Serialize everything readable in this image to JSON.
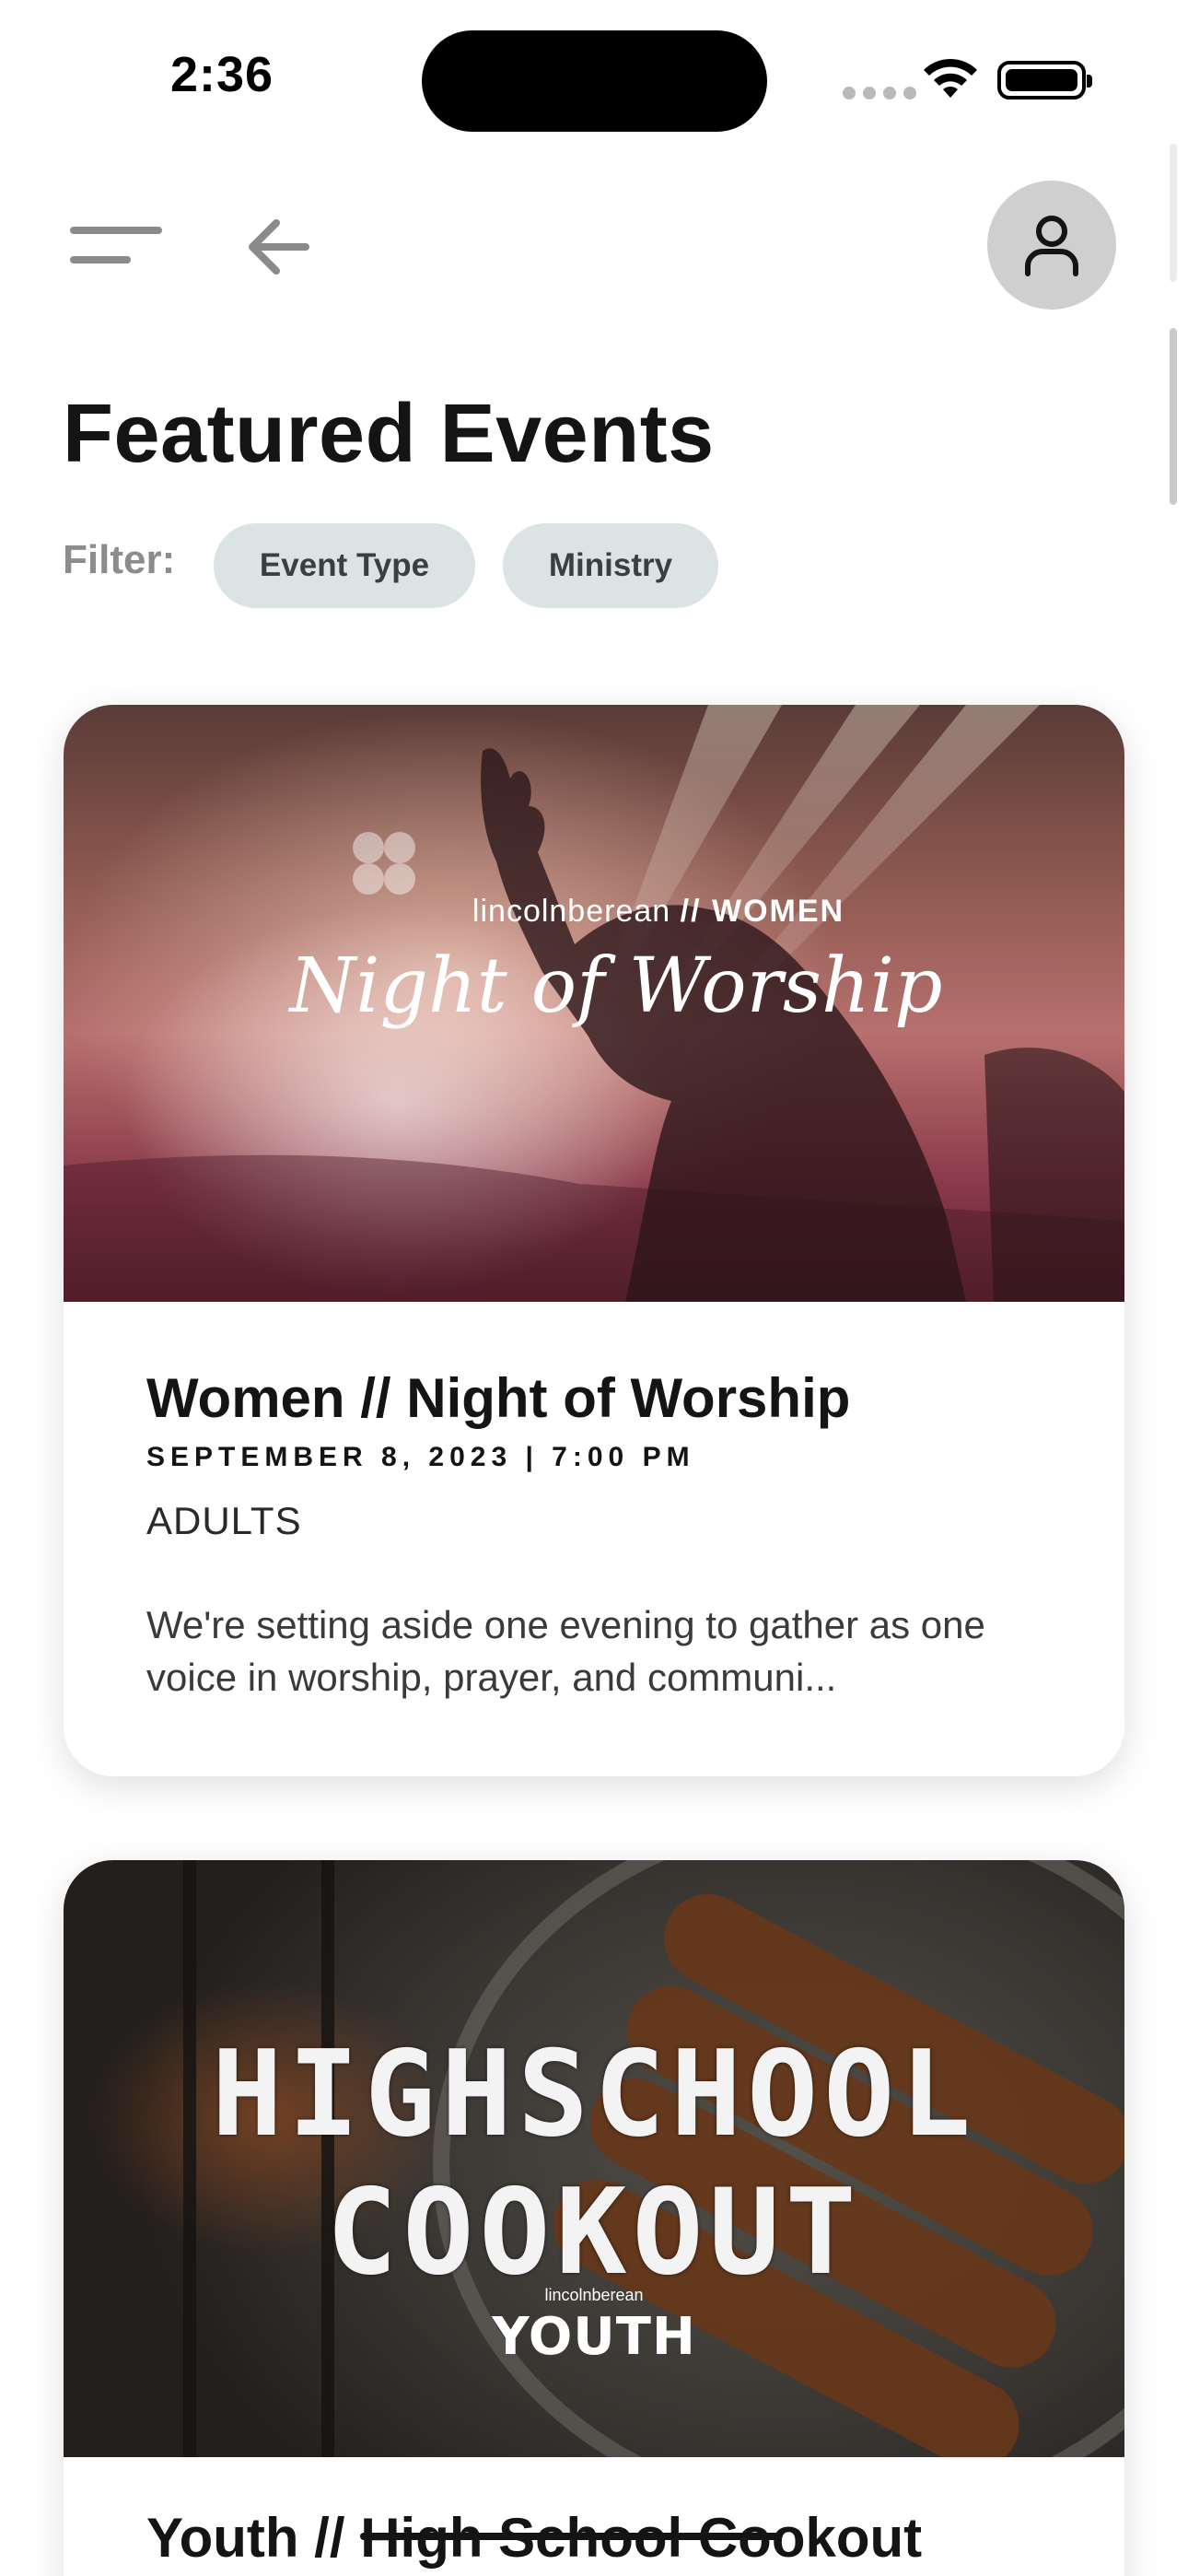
{
  "status_bar": {
    "time": "2:36"
  },
  "header": {
    "menu_icon": "hamburger-menu-icon",
    "back_icon": "arrow-left-icon",
    "profile_icon": "user-icon"
  },
  "page": {
    "title": "Featured Events",
    "filter_label": "Filter:",
    "filters": [
      {
        "label": "Event Type"
      },
      {
        "label": "Ministry"
      }
    ]
  },
  "events": [
    {
      "image": {
        "brand_prefix": "lincolnberean",
        "brand_suffix": "// WOMEN",
        "title": "Night of Worship"
      },
      "title": "Women // Night of Worship",
      "datetime": "SEPTEMBER 8, 2023 | 7:00 PM",
      "category": "ADULTS",
      "description": "We're setting aside one evening to gather as one voice in worship, prayer, and communi..."
    },
    {
      "image": {
        "title_line1": "HIGHSCHOOL",
        "title_line2": "COOKOUT",
        "brand": "lincolnberean",
        "ministry": "YOUTH"
      },
      "title_prefix": "Youth // ",
      "title_struck": "High School Cookout"
    }
  ],
  "colors": {
    "chip_bg": "#dce3e4",
    "profile_bg": "#cfcfcf",
    "text_primary": "#141414",
    "filter_label": "#8c8c8c"
  }
}
